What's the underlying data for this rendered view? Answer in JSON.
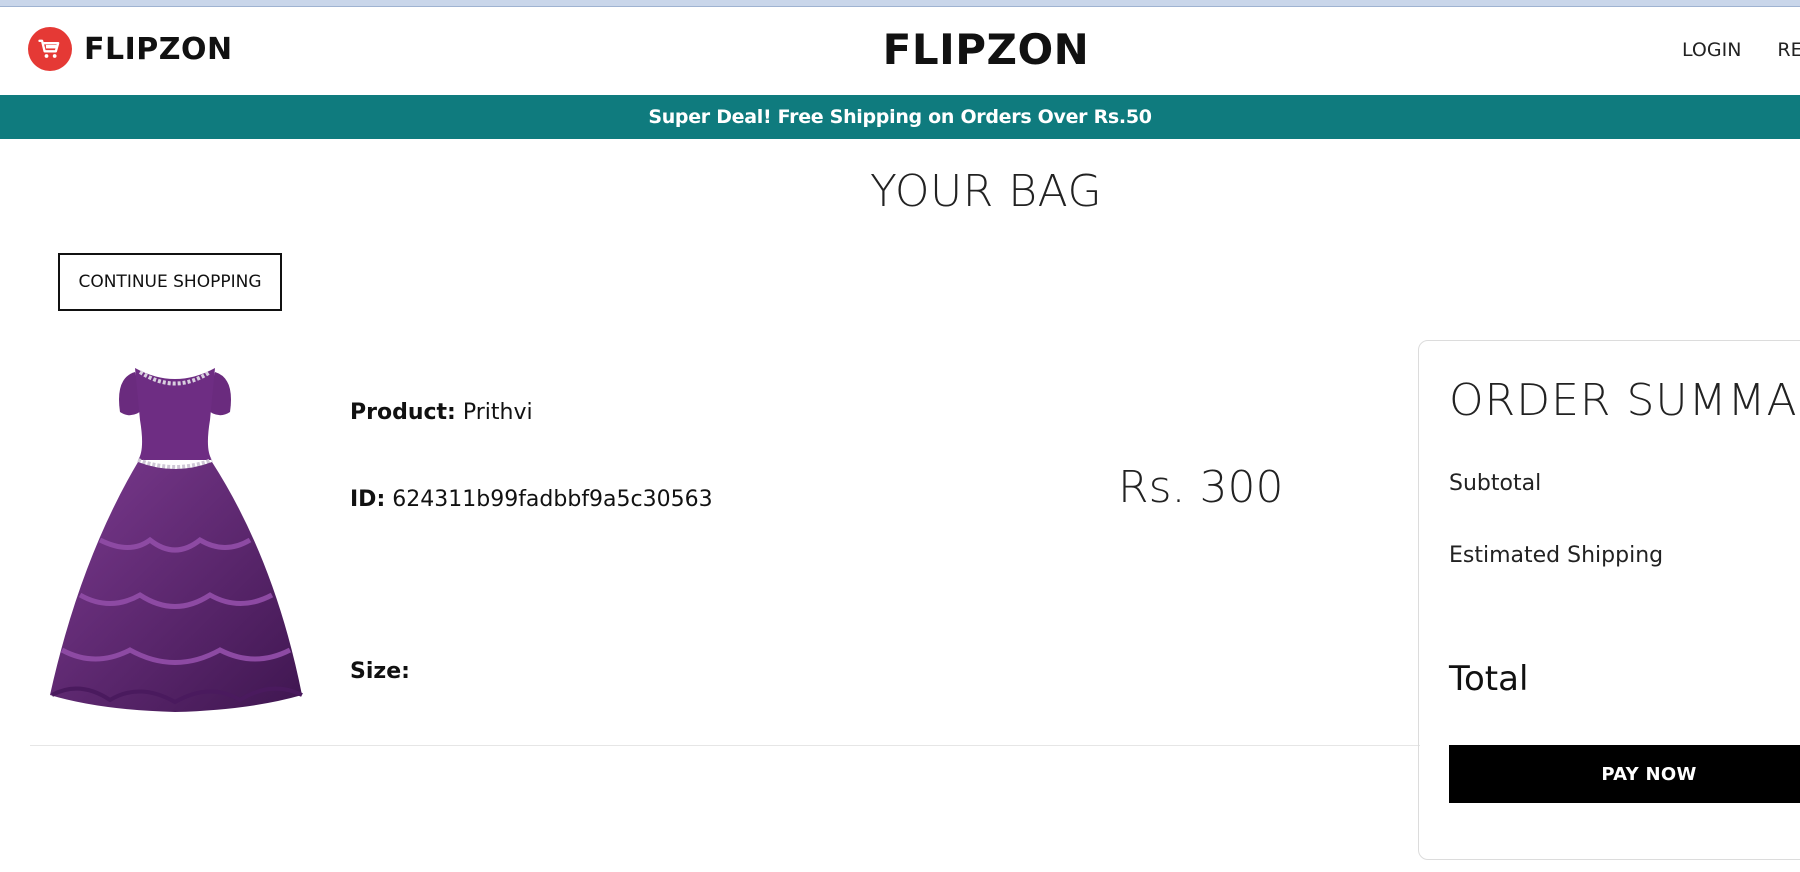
{
  "header": {
    "brand_name": "FLIPZON",
    "center_title": "FLIPZON",
    "nav": {
      "login": "LOGIN",
      "register": "RE"
    },
    "logo_icon": "shopping-cart-icon",
    "colors": {
      "logo_bg": "#e53935"
    }
  },
  "announcement": {
    "text": "Super Deal! Free Shipping on Orders Over Rs.50",
    "bg_color": "#0f7b7e"
  },
  "page": {
    "title": "YOUR BAG",
    "continue_label": "CONTINUE SHOPPING"
  },
  "cart": {
    "items": [
      {
        "product_label": "Product:",
        "product_value": "Prithvi",
        "id_label": "ID:",
        "id_value": "624311b99fadbbf9a5c30563",
        "size_label": "Size:",
        "size_value": "",
        "price": "Rs. 300",
        "image": "purple-gown"
      }
    ]
  },
  "summary": {
    "title": "ORDER SUMMARY",
    "subtotal_label": "Subtotal",
    "shipping_label": "Estimated Shipping",
    "total_label": "Total",
    "pay_label": "PAY NOW"
  }
}
